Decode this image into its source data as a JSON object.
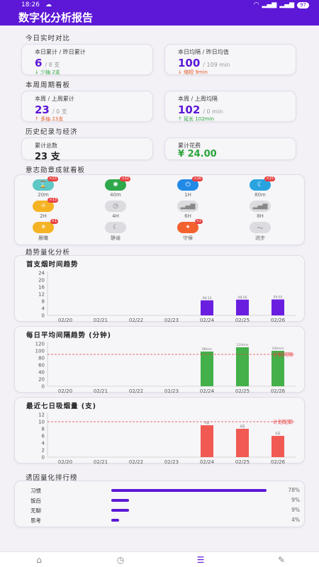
{
  "status": {
    "time": "18:26",
    "battery": "97"
  },
  "header": {
    "title": "数字化分析报告"
  },
  "today": {
    "section": "今日实时对比",
    "count": {
      "label": "本日累计 / 昨日累计",
      "value": "6",
      "unit": "/ 8 支",
      "sub": "↓ 少抽 2支"
    },
    "interval": {
      "label": "本日均隔 / 昨日均值",
      "value": "100",
      "unit": "/ 109 min",
      "sub": "↓ 缩短 9min"
    }
  },
  "week": {
    "section": "本周周期看板",
    "count": {
      "label": "本周 / 上周累计",
      "value": "23",
      "unit": "/ 0 支",
      "sub": "↑ 多抽 23支"
    },
    "interval": {
      "label": "本周 / 上周均隔",
      "value": "102",
      "unit": "/ 0 min",
      "sub": "↑ 延长 102min"
    }
  },
  "history": {
    "section": "历史纪录与经济",
    "total": {
      "label": "累计总数",
      "value": "23 支"
    },
    "spend": {
      "label": "累计花费",
      "value": "¥ 24.00"
    }
  },
  "badges": {
    "section": "意志勋章成就看板",
    "items": [
      {
        "label": "20m",
        "icon": "hourglass-icon",
        "glyph": "⌛",
        "color": "#5ec8c4",
        "count": "×23",
        "active": true
      },
      {
        "label": "40m",
        "icon": "dumbbell-icon",
        "glyph": "✱",
        "color": "#2ea84a",
        "count": "×22",
        "active": true
      },
      {
        "label": "1H",
        "icon": "timer-icon",
        "glyph": "⏻",
        "color": "#2189e6",
        "count": "×16",
        "active": true
      },
      {
        "label": "80m",
        "icon": "moon-icon",
        "glyph": "☾",
        "color": "#2aa4e0",
        "count": "×15",
        "active": true
      },
      {
        "label": "2H",
        "icon": "sun-icon",
        "glyph": "☼",
        "color": "#f5b324",
        "count": "×13",
        "active": true
      },
      {
        "label": "4H",
        "icon": "clock-icon",
        "glyph": "◷",
        "color": "#dcdbe0",
        "count": "",
        "active": false
      },
      {
        "label": "6H",
        "icon": "chart-icon",
        "glyph": "▂▄▆",
        "color": "#dcdbe0",
        "count": "",
        "active": false
      },
      {
        "label": "8H",
        "icon": "chart-icon",
        "glyph": "▂▄▆",
        "color": "#dcdbe0",
        "count": "",
        "active": false
      },
      {
        "label": "晨曦",
        "icon": "sunrise-icon",
        "glyph": "☀",
        "color": "#f5b324",
        "count": "×1",
        "active": true
      },
      {
        "label": "静谧",
        "icon": "moon-icon",
        "glyph": "☾",
        "color": "#dcdbe0",
        "count": "",
        "active": false
      },
      {
        "label": "守候",
        "icon": "flame-icon",
        "glyph": "✦",
        "color": "#f2612e",
        "count": "×2",
        "active": true
      },
      {
        "label": "进步",
        "icon": "trend-icon",
        "glyph": "〜",
        "color": "#dcdbe0",
        "count": "",
        "active": false
      }
    ]
  },
  "trend": {
    "section": "趋势量化分析"
  },
  "chart_data": [
    {
      "type": "bar",
      "title": "首支烟时间趋势",
      "categories": [
        "02/20",
        "02/21",
        "02/22",
        "02/23",
        "02/24",
        "02/25",
        "02/26"
      ],
      "values": [
        0,
        0,
        0,
        0,
        8.5,
        8.9,
        9.0
      ],
      "data_labels": [
        "",
        "",
        "",
        "",
        "08:33",
        "08:56",
        "09:02"
      ],
      "yticks": [
        0,
        4,
        8,
        12,
        16,
        20,
        24
      ],
      "ylim": [
        0,
        24
      ],
      "color": "#6a1ee0",
      "grid": false
    },
    {
      "type": "bar",
      "title": "每日平均间隔趋势 (分钟)",
      "categories": [
        "02/20",
        "02/21",
        "02/22",
        "02/23",
        "02/24",
        "02/25",
        "02/26"
      ],
      "values": [
        0,
        0,
        0,
        0,
        98,
        110,
        100
      ],
      "data_labels": [
        "",
        "",
        "",
        "",
        "98min",
        "110min",
        "100min"
      ],
      "yticks": [
        0,
        20,
        40,
        60,
        80,
        100,
        120
      ],
      "ylim": [
        0,
        120
      ],
      "color": "#43b04a",
      "reference": {
        "value": 90,
        "label": "计划间隔"
      },
      "grid": false
    },
    {
      "type": "bar",
      "title": "最近七日吸烟量 (支)",
      "categories": [
        "02/20",
        "02/21",
        "02/22",
        "02/23",
        "02/24",
        "02/25",
        "02/26"
      ],
      "values": [
        0,
        0,
        0,
        0,
        9,
        8,
        6
      ],
      "data_labels": [
        "",
        "",
        "",
        "",
        "9支",
        "8支",
        "6支"
      ],
      "yticks": [
        0,
        2,
        4,
        6,
        8,
        10,
        12
      ],
      "ylim": [
        0,
        12
      ],
      "color": "#f05a52",
      "reference": {
        "value": 10,
        "label": "计划配额"
      },
      "grid": false
    }
  ],
  "ranking": {
    "section": "诱因量化排行榜",
    "items": [
      {
        "name": "习惯",
        "value": 78,
        "pct": "78%"
      },
      {
        "name": "饭后",
        "value": 9,
        "pct": "9%"
      },
      {
        "name": "无聊",
        "value": 9,
        "pct": "9%"
      },
      {
        "name": "思考",
        "value": 4,
        "pct": "4%"
      }
    ]
  },
  "nav": {
    "items": [
      {
        "icon": "home-icon",
        "glyph": "⌂"
      },
      {
        "icon": "history-icon",
        "glyph": "◷"
      },
      {
        "icon": "report-icon",
        "glyph": "☰"
      },
      {
        "icon": "settings-icon",
        "glyph": "✎"
      }
    ]
  }
}
